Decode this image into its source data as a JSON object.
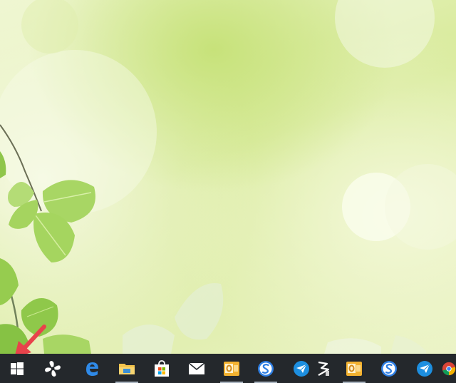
{
  "screen": {
    "wallpaper": "green-leaves-bokeh"
  },
  "taskbar": {
    "background": "#24282c",
    "items": [
      {
        "name": "start-button",
        "icon": "windows-logo-icon"
      },
      {
        "name": "pinwheel-app-button",
        "icon": "pinwheel-icon"
      },
      {
        "name": "edge-browser-button",
        "icon": "edge-icon"
      },
      {
        "name": "file-explorer-button",
        "icon": "folder-icon",
        "running": true
      },
      {
        "name": "store-button",
        "icon": "store-bag-icon"
      },
      {
        "name": "mail-button",
        "icon": "envelope-icon"
      },
      {
        "name": "outlook-button",
        "icon": "outlook-icon",
        "running": true
      },
      {
        "name": "sogou-input-button",
        "icon": "sogou-s-icon",
        "running": true
      },
      {
        "name": "paper-plane-app-button",
        "icon": "paper-plane-icon"
      },
      {
        "name": "zip-archive-button",
        "icon": "zip-icon"
      },
      {
        "name": "outlook-second-button",
        "icon": "outlook-icon",
        "running": true
      },
      {
        "name": "sogou-input-second-button",
        "icon": "sogou-s-icon"
      },
      {
        "name": "paper-plane-second-button",
        "icon": "paper-plane-icon"
      },
      {
        "name": "chrome-button",
        "icon": "chrome-icon"
      }
    ]
  },
  "annotation": {
    "arrow_color": "#e8434b",
    "points_to": "start-button"
  }
}
